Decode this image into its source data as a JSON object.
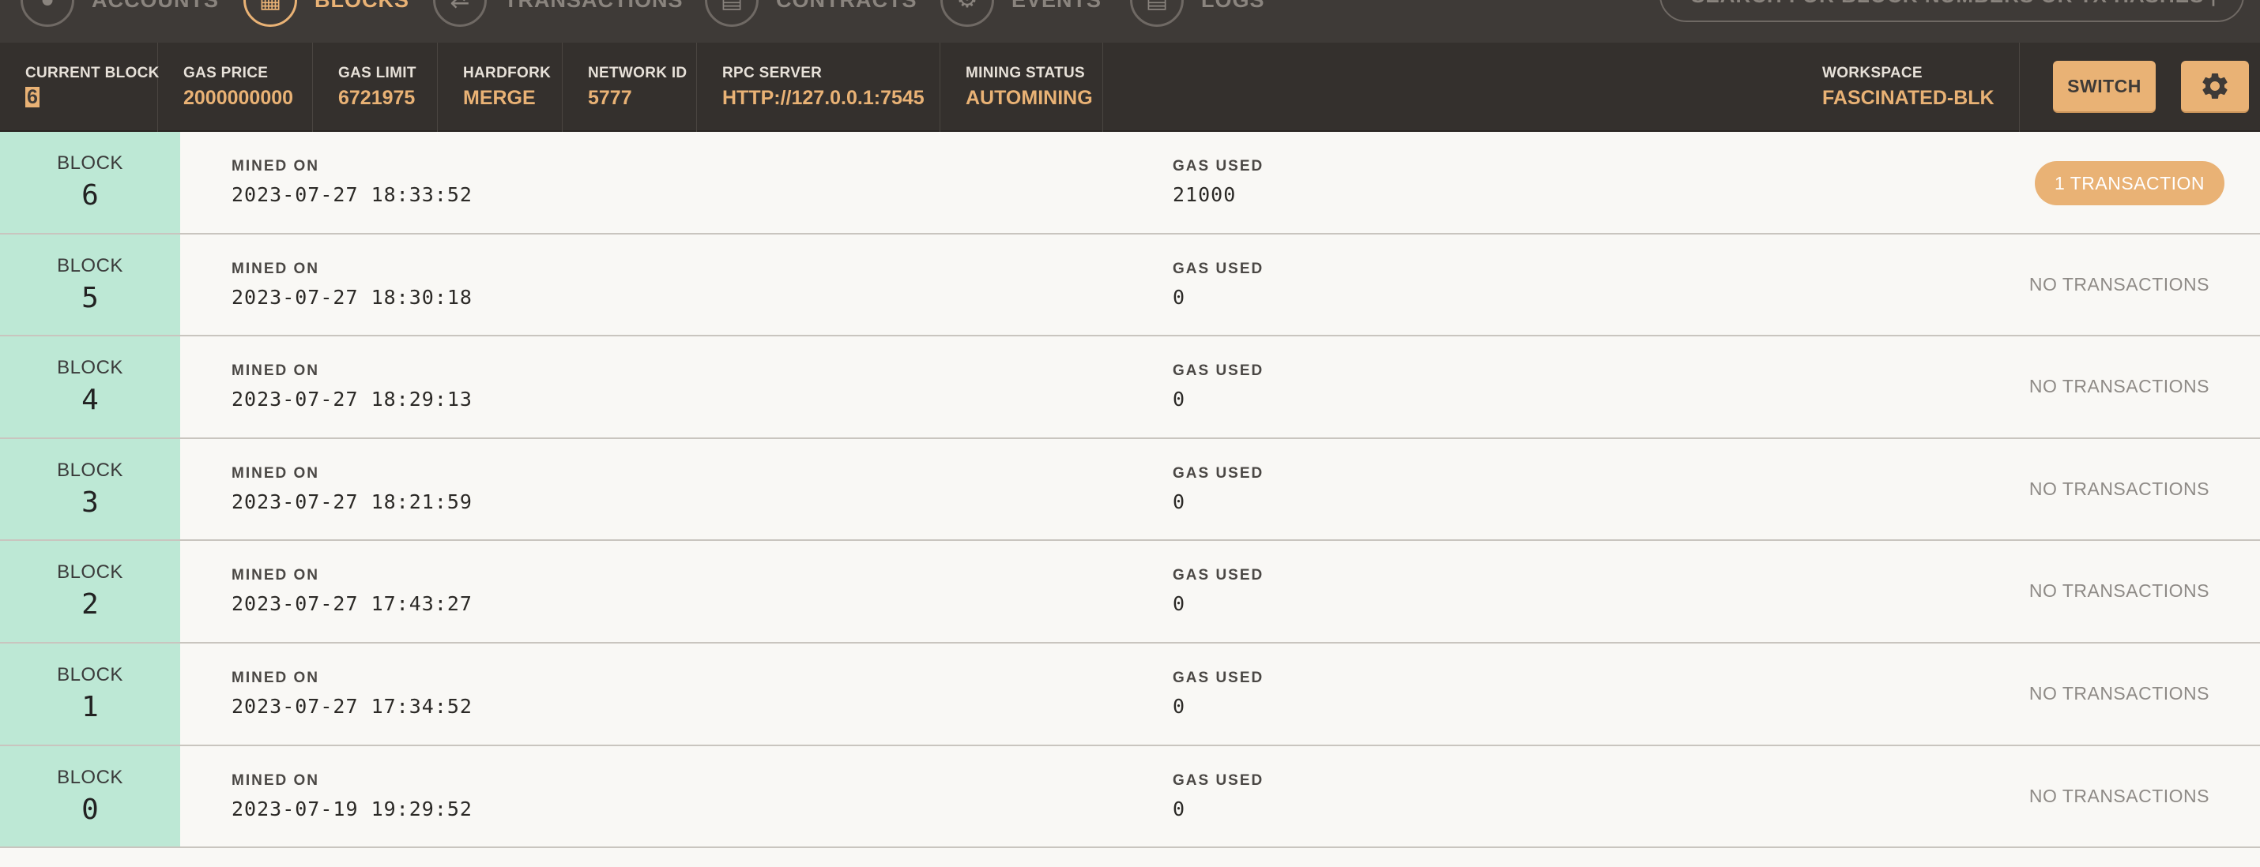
{
  "nav": {
    "items": [
      {
        "label": "ACCOUNTS",
        "icon": "accounts-icon"
      },
      {
        "label": "BLOCKS",
        "icon": "blocks-icon",
        "active": true
      },
      {
        "label": "TRANSACTIONS",
        "icon": "transactions-icon"
      },
      {
        "label": "CONTRACTS",
        "icon": "contracts-icon"
      },
      {
        "label": "EVENTS",
        "icon": "events-icon"
      },
      {
        "label": "LOGS",
        "icon": "logs-icon"
      }
    ],
    "search_placeholder": "SEARCH FOR BLOCK NUMBERS OR TX HASHES"
  },
  "stats": {
    "current_block": {
      "label": "CURRENT BLOCK",
      "value": "6"
    },
    "gas_price": {
      "label": "GAS PRICE",
      "value": "2000000000"
    },
    "gas_limit": {
      "label": "GAS LIMIT",
      "value": "6721975"
    },
    "hardfork": {
      "label": "HARDFORK",
      "value": "MERGE"
    },
    "network_id": {
      "label": "NETWORK ID",
      "value": "5777"
    },
    "rpc_server": {
      "label": "RPC SERVER",
      "value": "HTTP://127.0.0.1:7545"
    },
    "mining_status": {
      "label": "MINING STATUS",
      "value": "AUTOMINING"
    },
    "workspace": {
      "label": "WORKSPACE",
      "value": "FASCINATED-BLK"
    },
    "switch_label": "SWITCH"
  },
  "labels": {
    "block": "BLOCK",
    "mined_on": "MINED ON",
    "gas_used": "GAS USED"
  },
  "blocks": [
    {
      "number": "6",
      "mined_on": "2023-07-27 18:33:52",
      "gas_used": "21000",
      "tx": "1 TRANSACTION",
      "has_tx": true
    },
    {
      "number": "5",
      "mined_on": "2023-07-27 18:30:18",
      "gas_used": "0",
      "tx": "NO TRANSACTIONS",
      "has_tx": false
    },
    {
      "number": "4",
      "mined_on": "2023-07-27 18:29:13",
      "gas_used": "0",
      "tx": "NO TRANSACTIONS",
      "has_tx": false
    },
    {
      "number": "3",
      "mined_on": "2023-07-27 18:21:59",
      "gas_used": "0",
      "tx": "NO TRANSACTIONS",
      "has_tx": false
    },
    {
      "number": "2",
      "mined_on": "2023-07-27 17:43:27",
      "gas_used": "0",
      "tx": "NO TRANSACTIONS",
      "has_tx": false
    },
    {
      "number": "1",
      "mined_on": "2023-07-27 17:34:52",
      "gas_used": "0",
      "tx": "NO TRANSACTIONS",
      "has_tx": false
    },
    {
      "number": "0",
      "mined_on": "2023-07-19 19:29:52",
      "gas_used": "0",
      "tx": "NO TRANSACTIONS",
      "has_tx": false
    }
  ],
  "colors": {
    "accent": "#e9b275",
    "nav_bg": "#3e3a37",
    "stats_bg": "#34302d",
    "block_badge_bg": "#bde8d5",
    "row_bg": "#f9f8f5"
  }
}
